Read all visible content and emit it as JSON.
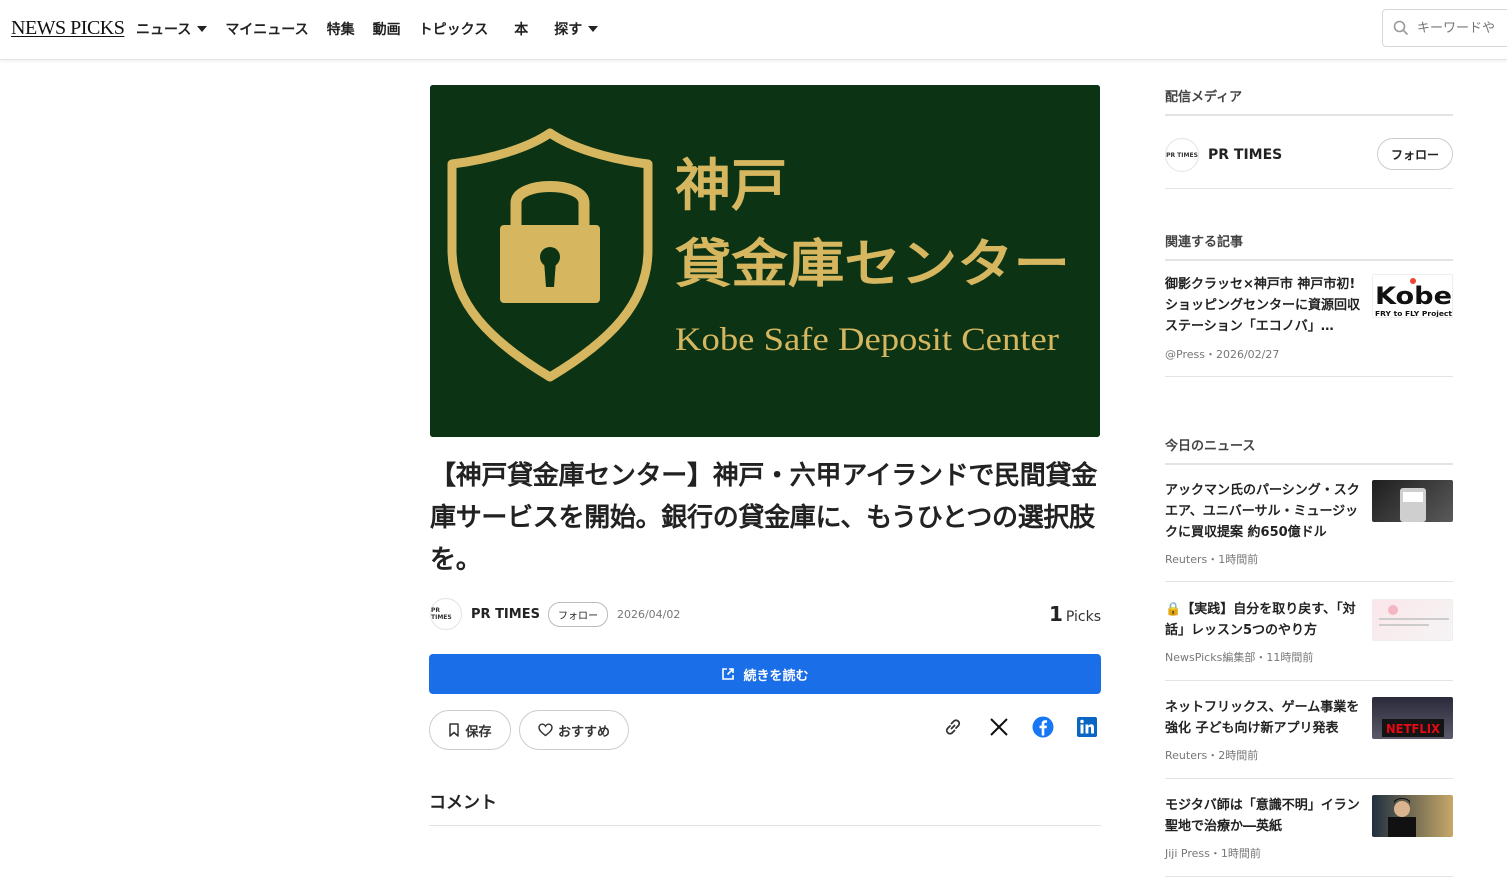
{
  "header": {
    "logo": "NEWS PICKS",
    "nav": [
      {
        "label": "ニュース",
        "has_dropdown": true
      },
      {
        "label": "マイニュース",
        "has_dropdown": false
      },
      {
        "label": "特集",
        "has_dropdown": false
      },
      {
        "label": "動画",
        "has_dropdown": false
      },
      {
        "label": "トピックス",
        "has_dropdown": false
      },
      {
        "label": "本",
        "has_dropdown": false
      },
      {
        "label": "探す",
        "has_dropdown": true
      }
    ],
    "search_placeholder": "キーワードや"
  },
  "hero": {
    "line1": "神戸",
    "line2": "貸金庫センター",
    "line3": "Kobe Safe Deposit Center",
    "bg_color": "#0c3314",
    "gold_color": "#d6b760"
  },
  "article": {
    "title": "【神戸貸金庫センター】神戸・六甲アイランドで民間貸金庫サービスを開始。銀行の貸金庫に、もうひとつの選択肢を。",
    "publisher_logo": "PR TIMES",
    "publisher": "PR TIMES",
    "follow_label": "フォロー",
    "date": "2026/04/02",
    "picks_count": "1",
    "picks_label": "Picks",
    "read_more": "続きを読む",
    "save_label": "保存",
    "recommend_label": "おすすめ",
    "comments_heading": "コメント",
    "accent_color": "#1a6ee8"
  },
  "sidebar": {
    "media_heading": "配信メディア",
    "media": {
      "logo": "PR TIMES",
      "name": "PR TIMES",
      "follow_label": "フォロー"
    },
    "related_heading": "関連する記事",
    "related": [
      {
        "title": "御影クラッセ×神戸市 神戸市初!ショッピングセンターに資源回収ステーション「エコノバ」…",
        "meta": "@Press・2026/02/27",
        "thumb_text": "Kobe",
        "thumb_sub": "FRY to FLY Project"
      }
    ],
    "today_heading": "今日のニュース",
    "today": [
      {
        "title": "アックマン氏のパーシング・スクエア、ユニバーサル・ミュージックに買収提案 約650億ドル",
        "meta": "Reuters・1時間前",
        "locked": false
      },
      {
        "title": "【実践】自分を取り戻す、「対話」レッスン5つのやり方",
        "meta": "NewsPicks編集部・11時間前",
        "locked": true
      },
      {
        "title": "ネットフリックス、ゲーム事業を強化 子ども向け新アプリ発表",
        "meta": "Reuters・2時間前",
        "locked": false,
        "thumb_text": "NETFLIX"
      },
      {
        "title": "モジタバ師は「意識不明」イラン聖地で治療か―英紙",
        "meta": "Jiji Press・1時間前",
        "locked": false
      }
    ]
  }
}
